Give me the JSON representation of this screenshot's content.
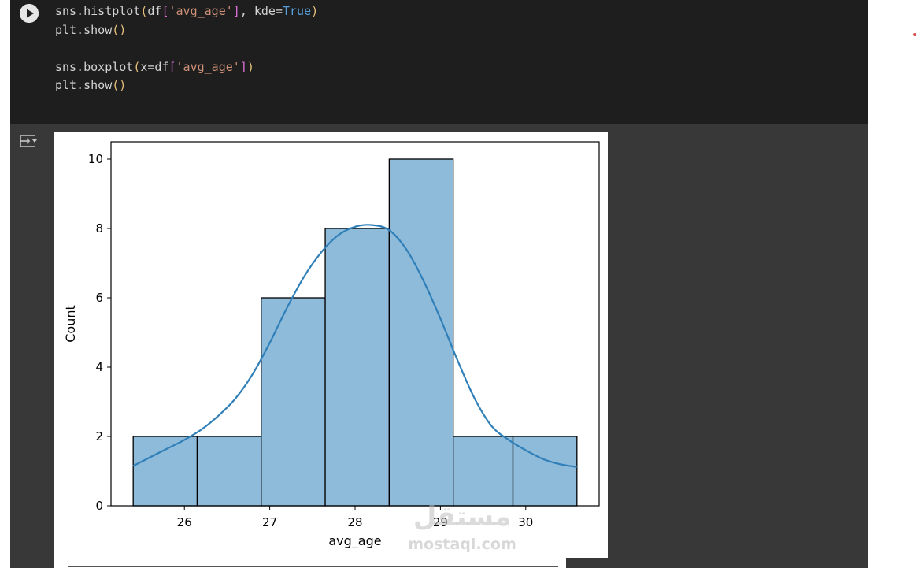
{
  "code_cell": {
    "lines": [
      [
        {
          "t": "sns.histplot",
          "c": "plain"
        },
        {
          "t": "(",
          "c": "paren"
        },
        {
          "t": "df",
          "c": "plain"
        },
        {
          "t": "[",
          "c": "bracket"
        },
        {
          "t": "'avg_age'",
          "c": "str"
        },
        {
          "t": "]",
          "c": "bracket"
        },
        {
          "t": ", kde=",
          "c": "plain"
        },
        {
          "t": "True",
          "c": "kw"
        },
        {
          "t": ")",
          "c": "paren"
        }
      ],
      [
        {
          "t": "plt.show",
          "c": "plain"
        },
        {
          "t": "()",
          "c": "paren"
        }
      ],
      [],
      [
        {
          "t": "sns.boxplot",
          "c": "plain"
        },
        {
          "t": "(",
          "c": "paren"
        },
        {
          "t": "x=df",
          "c": "plain"
        },
        {
          "t": "[",
          "c": "bracket"
        },
        {
          "t": "'avg_age'",
          "c": "str"
        },
        {
          "t": "]",
          "c": "bracket"
        },
        {
          "t": ")",
          "c": "paren"
        }
      ],
      [
        {
          "t": "plt.show",
          "c": "plain"
        },
        {
          "t": "()",
          "c": "paren"
        }
      ]
    ]
  },
  "icons": {
    "run": "play-icon",
    "output_toggle": "output-toggle-icon"
  },
  "chart_data": {
    "type": "bar",
    "subtype": "histogram-with-kde",
    "bin_edges": [
      25.4,
      26.15,
      26.9,
      27.65,
      28.4,
      29.15,
      29.85,
      30.6
    ],
    "values": [
      2,
      2,
      6,
      8,
      10,
      2,
      2
    ],
    "kde": {
      "x": [
        25.4,
        25.6,
        25.8,
        26.0,
        26.2,
        26.4,
        26.6,
        26.8,
        27.0,
        27.2,
        27.4,
        27.6,
        27.8,
        28.0,
        28.2,
        28.4,
        28.6,
        28.8,
        29.0,
        29.2,
        29.4,
        29.6,
        29.8,
        30.0,
        30.2,
        30.4,
        30.6
      ],
      "y": [
        1.15,
        1.4,
        1.65,
        1.9,
        2.2,
        2.6,
        3.1,
        3.8,
        4.7,
        5.7,
        6.6,
        7.3,
        7.8,
        8.05,
        8.1,
        7.95,
        7.4,
        6.5,
        5.4,
        4.2,
        3.1,
        2.3,
        1.9,
        1.6,
        1.35,
        1.2,
        1.12
      ]
    },
    "xlabel": "avg_age",
    "ylabel": "Count",
    "xticks": [
      "26",
      "27",
      "28",
      "29",
      "30"
    ],
    "xtick_values": [
      26,
      27,
      28,
      29,
      30
    ],
    "yticks": [
      "0",
      "2",
      "4",
      "6",
      "8",
      "10"
    ],
    "ytick_values": [
      0,
      2,
      4,
      6,
      8,
      10
    ],
    "xlim": [
      25.14,
      30.86
    ],
    "ylim": [
      0,
      10.5
    ],
    "colors": {
      "bar_fill": "#8fbbdb",
      "bar_edge": "#000000",
      "kde_line": "#2f7fb8"
    },
    "grid": false,
    "legend": "none"
  },
  "watermark": {
    "arabic": "مستقل",
    "latin": "mostaql.com"
  }
}
